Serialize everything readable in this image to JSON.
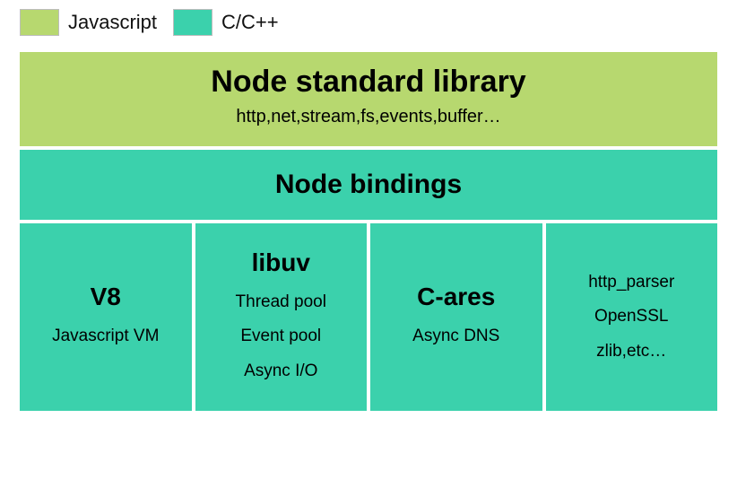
{
  "colors": {
    "javascript": "#b7d86f",
    "cpp": "#3bd1ac"
  },
  "legend": {
    "js": "Javascript",
    "c": "C/C++"
  },
  "stdlib": {
    "title": "Node standard library",
    "subtitle": "http,net,stream,fs,events,buffer…"
  },
  "bindings": {
    "title": "Node bindings"
  },
  "bottom": {
    "v8": {
      "title": "V8",
      "sub1": "Javascript VM"
    },
    "libuv": {
      "title": "libuv",
      "sub1": "Thread pool",
      "sub2": "Event pool",
      "sub3": "Async I/O"
    },
    "cares": {
      "title": "C-ares",
      "sub1": "Async DNS"
    },
    "misc": {
      "sub1": "http_parser",
      "sub2": "OpenSSL",
      "sub3": "zlib,etc…"
    }
  }
}
